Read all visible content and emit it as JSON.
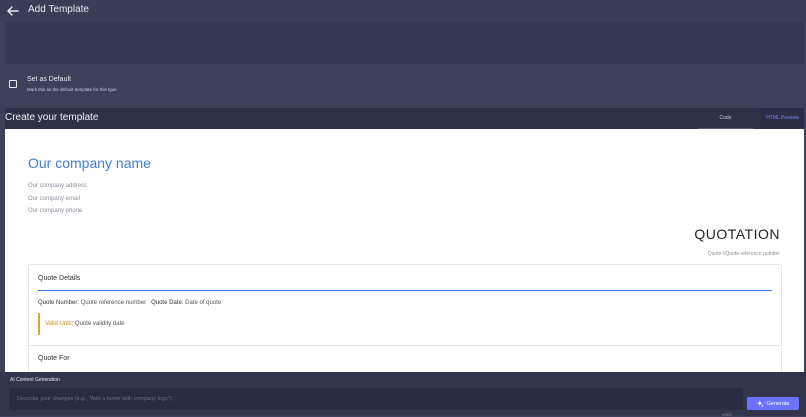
{
  "header": {
    "title": "Add Template"
  },
  "default_option": {
    "label": "Set as Default",
    "help": "Mark this as the default template for this type"
  },
  "editor": {
    "title": "Create your template",
    "tabs": [
      {
        "label": "Code"
      },
      {
        "label": "HTML Preview"
      }
    ],
    "active_tab": "HTML Preview"
  },
  "preview": {
    "company_name": "Our company name",
    "contact": [
      "Our company address",
      "Our company email",
      "Our company phone"
    ],
    "doc_title": "QUOTATION",
    "quote_ref": "Quote #Quote reference number",
    "details": {
      "title": "Quote Details",
      "number_label": "Quote Number:",
      "number_value": "Quote reference number",
      "date_label": "Quote Date:",
      "date_value": "Date of quote",
      "valid_label": "Valid Until:",
      "valid_value": "Quote validity date"
    },
    "quote_for": {
      "title": "Quote For"
    }
  },
  "ai": {
    "title": "AI Content Generation",
    "placeholder": "Describe your changes (e.g., \"Add a footer with company logo\")",
    "counter": "0/500",
    "generate_label": "Generate"
  },
  "colors": {
    "accent": "#6b72ff",
    "company_blue": "#3b7be0",
    "valid_gold": "#c98c18"
  },
  "icons": {
    "back": "arrow-left-icon",
    "generate": "sparkle-icon"
  }
}
